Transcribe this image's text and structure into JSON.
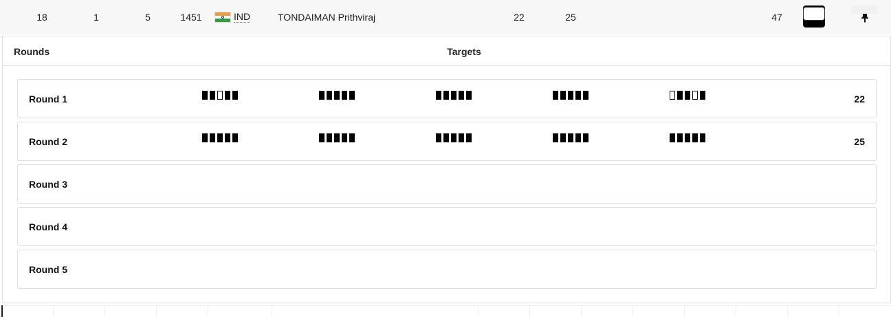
{
  "row": {
    "rank": "18",
    "squad": "1",
    "position": "5",
    "bib": "1451",
    "country": "IND",
    "flag_colors": [
      "#f29a38",
      "#ffffff",
      "#2f9e3f"
    ],
    "name": "TONDAIMAN Prithviraj",
    "r1_total": "22",
    "r2_total": "25",
    "total": "47",
    "collapse_icon": "minus-icon",
    "pin_icon": "pin-icon"
  },
  "panel": {
    "rounds_header": "Rounds",
    "targets_header": "Targets",
    "rounds": [
      {
        "label": "Round 1",
        "score": "22",
        "series": [
          [
            1,
            1,
            0,
            1,
            1
          ],
          [
            1,
            1,
            1,
            1,
            1
          ],
          [
            1,
            1,
            1,
            1,
            1
          ],
          [
            1,
            1,
            1,
            1,
            1
          ],
          [
            0,
            1,
            1,
            0,
            1
          ]
        ]
      },
      {
        "label": "Round 2",
        "score": "25",
        "series": [
          [
            1,
            1,
            1,
            1,
            1
          ],
          [
            1,
            1,
            1,
            1,
            1
          ],
          [
            1,
            1,
            1,
            1,
            1
          ],
          [
            1,
            1,
            1,
            1,
            1
          ],
          [
            1,
            1,
            1,
            1,
            1
          ]
        ]
      },
      {
        "label": "Round 3",
        "score": "",
        "series": []
      },
      {
        "label": "Round 4",
        "score": "",
        "series": []
      },
      {
        "label": "Round 5",
        "score": "",
        "series": []
      }
    ]
  },
  "colors": {
    "hit": "#000000",
    "miss": "#ffffff",
    "accent_button": "#000000"
  }
}
